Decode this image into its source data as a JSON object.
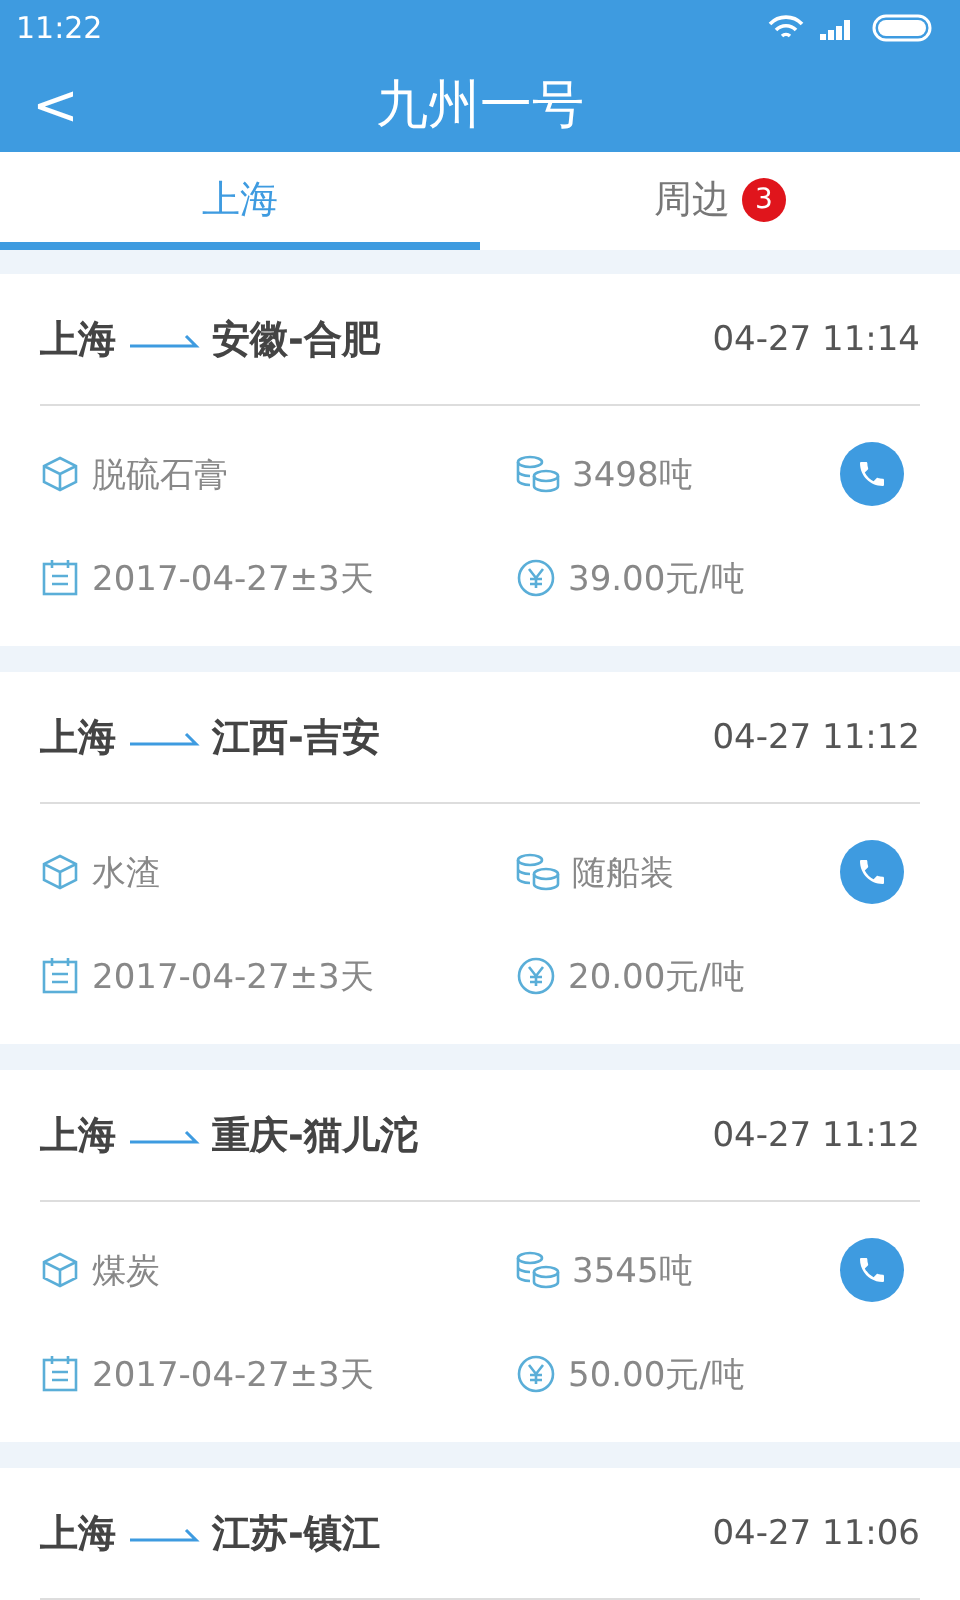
{
  "status_bar": {
    "time": "11:22"
  },
  "header": {
    "back": "<",
    "title": "九州一号"
  },
  "tabs": [
    {
      "label": "上海",
      "selected": true
    },
    {
      "label": "周边",
      "selected": false,
      "badge": "3"
    }
  ],
  "cards": [
    {
      "origin": "上海",
      "destination": "安徽-合肥",
      "time": "04-27 11:14",
      "cargo": "脱硫石膏",
      "quantity": "3498吨",
      "date": "2017-04-27±3天",
      "price": "39.00元/吨"
    },
    {
      "origin": "上海",
      "destination": "江西-吉安",
      "time": "04-27 11:12",
      "cargo": "水渣",
      "quantity": "随船装",
      "date": "2017-04-27±3天",
      "price": "20.00元/吨"
    },
    {
      "origin": "上海",
      "destination": "重庆-猫儿沱",
      "time": "04-27 11:12",
      "cargo": "煤炭",
      "quantity": "3545吨",
      "date": "2017-04-27±3天",
      "price": "50.00元/吨"
    },
    {
      "origin": "上海",
      "destination": "江苏-镇江",
      "time": "04-27 11:06"
    }
  ]
}
